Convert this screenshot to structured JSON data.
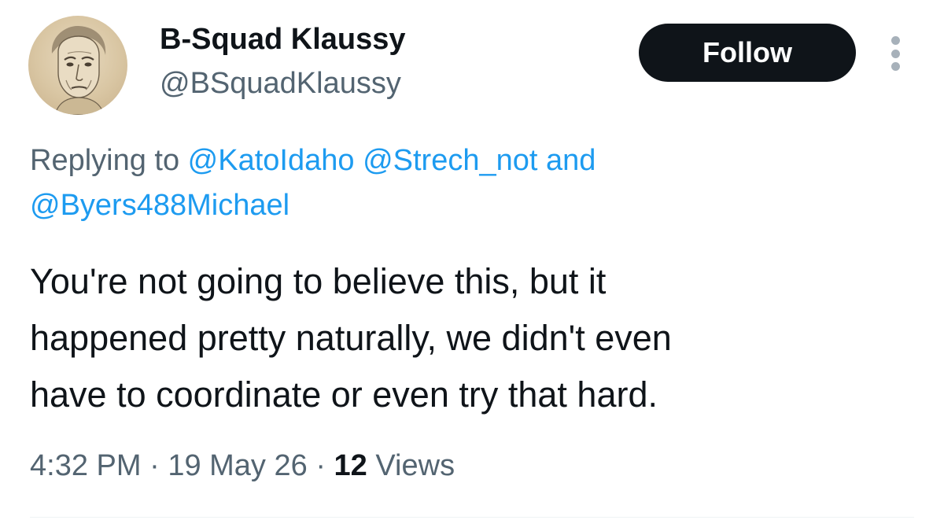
{
  "author": {
    "display_name": "B-Squad Klaussy",
    "handle": "@BSquadKlaussy",
    "avatar_icon": "profile-portrait-sketch"
  },
  "actions": {
    "follow_label": "Follow",
    "more_icon": "vertical-ellipsis-icon"
  },
  "reply": {
    "prefix": "Replying to ",
    "mentions": [
      "@KatoIdaho",
      "@Strech_not",
      "@Byers488Michael"
    ],
    "conjunction": " and"
  },
  "tweet": {
    "lines": [
      "You're not going to believe this, but it",
      "happened pretty naturally, we didn't even",
      "have to coordinate or even try that hard."
    ]
  },
  "meta": {
    "time": "4:32 PM",
    "separator": "·",
    "date": "19 May 26",
    "views_count": "12",
    "views_label": "Views"
  },
  "colors": {
    "text_primary": "#0f1419",
    "text_secondary": "#536471",
    "link": "#1d9bf0",
    "button_bg": "#0f1419",
    "button_text": "#ffffff"
  }
}
